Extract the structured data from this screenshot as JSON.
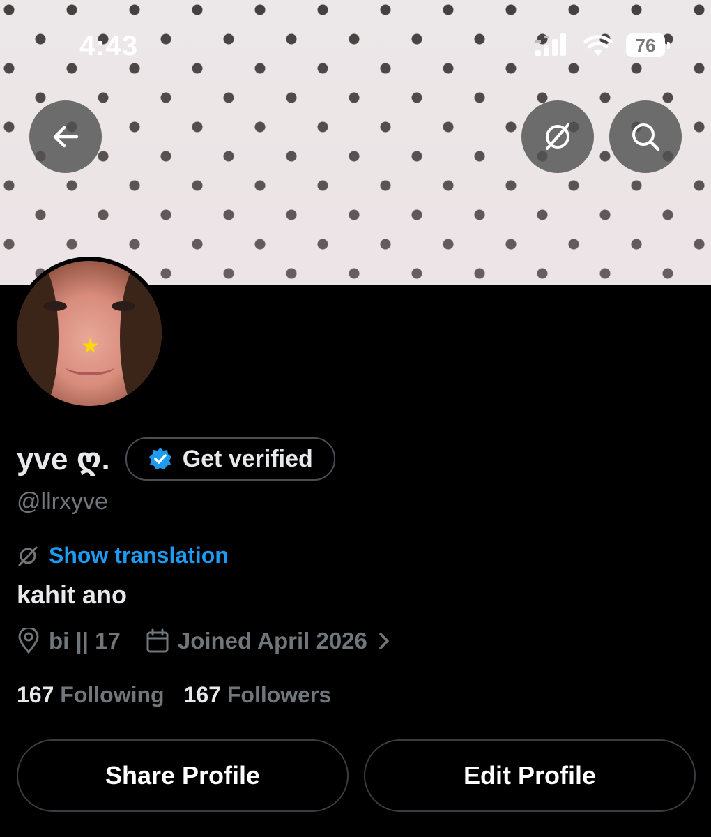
{
  "status_bar": {
    "time": "4:43",
    "battery": "76"
  },
  "profile": {
    "display_name": "yve ღ.",
    "verify_label": "Get verified",
    "handle": "@llrxyve",
    "translation_label": "Show translation",
    "bio": "kahit ano",
    "location": "bi || 17",
    "joined": "Joined April 2026",
    "following_count": "167",
    "following_label": "Following",
    "followers_count": "167",
    "followers_label": "Followers"
  },
  "actions": {
    "share": "Share Profile",
    "edit": "Edit Profile"
  },
  "colors": {
    "accent": "#1d9bf0",
    "muted": "#71767b",
    "background": "#000000"
  }
}
